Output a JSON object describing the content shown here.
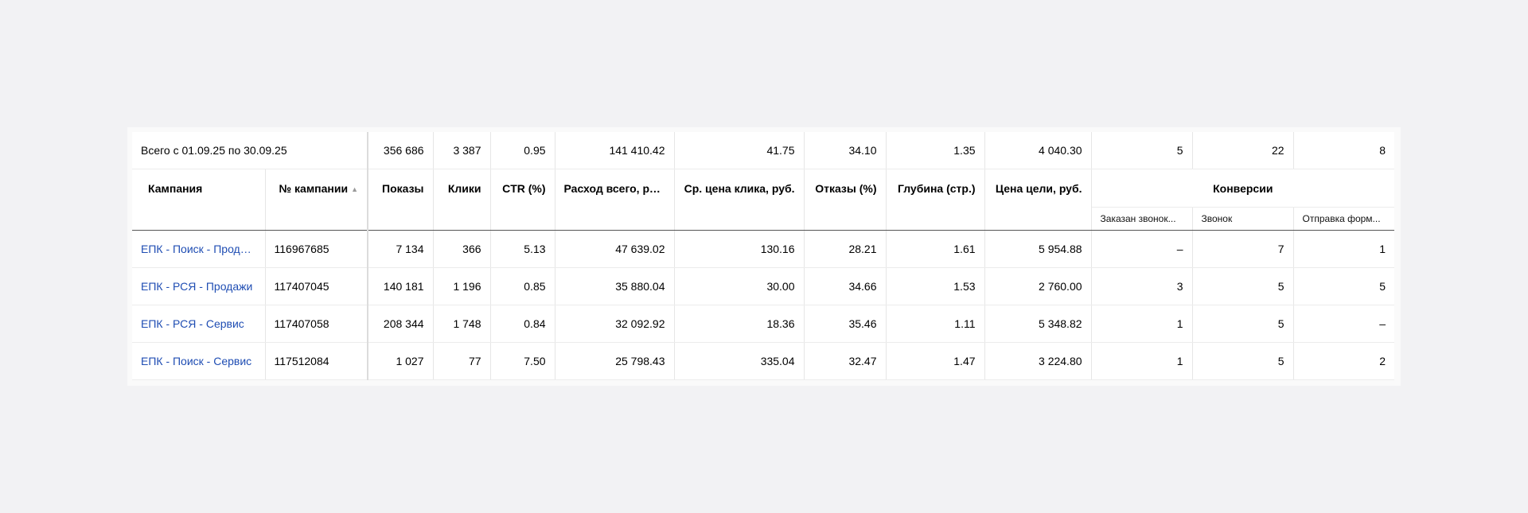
{
  "totals": {
    "label": "Всего с 01.09.25 по 30.09.25",
    "shows": "356 686",
    "clicks": "3 387",
    "ctr": "0.95",
    "spend": "141 410.42",
    "cpc": "41.75",
    "bounce": "34.10",
    "depth": "1.35",
    "goal_price": "4 040.30",
    "conv_call_ordered": "5",
    "conv_call": "22",
    "conv_form": "8"
  },
  "headers": {
    "campaign": "Кампания",
    "campaign_id": "№ кампании",
    "shows": "Показы",
    "clicks": "Клики",
    "ctr": "CTR (%)",
    "spend": "Расход всего, руб.",
    "cpc": "Ср. цена клика, руб.",
    "bounce": "Отказы (%)",
    "depth": "Глубина (стр.)",
    "goal_price": "Цена цели, руб.",
    "conversions": "Конверсии",
    "conv_call_ordered": "Заказан звонок...",
    "conv_call": "Звонок",
    "conv_form": "Отправка форм..."
  },
  "sort_icon": "triangle-up-icon",
  "colors": {
    "link": "#1f4db3",
    "background": "#f2f2f4"
  },
  "rows": [
    {
      "campaign": "ЕПК - Поиск - Продажи",
      "campaign_id": "116967685",
      "shows": "7 134",
      "clicks": "366",
      "ctr": "5.13",
      "spend": "47 639.02",
      "cpc": "130.16",
      "bounce": "28.21",
      "depth": "1.61",
      "goal_price": "5 954.88",
      "conv_call_ordered": "–",
      "conv_call": "7",
      "conv_form": "1"
    },
    {
      "campaign": "ЕПК - РСЯ - Продажи",
      "campaign_id": "117407045",
      "shows": "140 181",
      "clicks": "1 196",
      "ctr": "0.85",
      "spend": "35 880.04",
      "cpc": "30.00",
      "bounce": "34.66",
      "depth": "1.53",
      "goal_price": "2 760.00",
      "conv_call_ordered": "3",
      "conv_call": "5",
      "conv_form": "5"
    },
    {
      "campaign": "ЕПК - РСЯ - Сервис",
      "campaign_id": "117407058",
      "shows": "208 344",
      "clicks": "1 748",
      "ctr": "0.84",
      "spend": "32 092.92",
      "cpc": "18.36",
      "bounce": "35.46",
      "depth": "1.11",
      "goal_price": "5 348.82",
      "conv_call_ordered": "1",
      "conv_call": "5",
      "conv_form": "–"
    },
    {
      "campaign": "ЕПК - Поиск - Сервис",
      "campaign_id": "117512084",
      "shows": "1 027",
      "clicks": "77",
      "ctr": "7.50",
      "spend": "25 798.43",
      "cpc": "335.04",
      "bounce": "32.47",
      "depth": "1.47",
      "goal_price": "3 224.80",
      "conv_call_ordered": "1",
      "conv_call": "5",
      "conv_form": "2"
    }
  ]
}
